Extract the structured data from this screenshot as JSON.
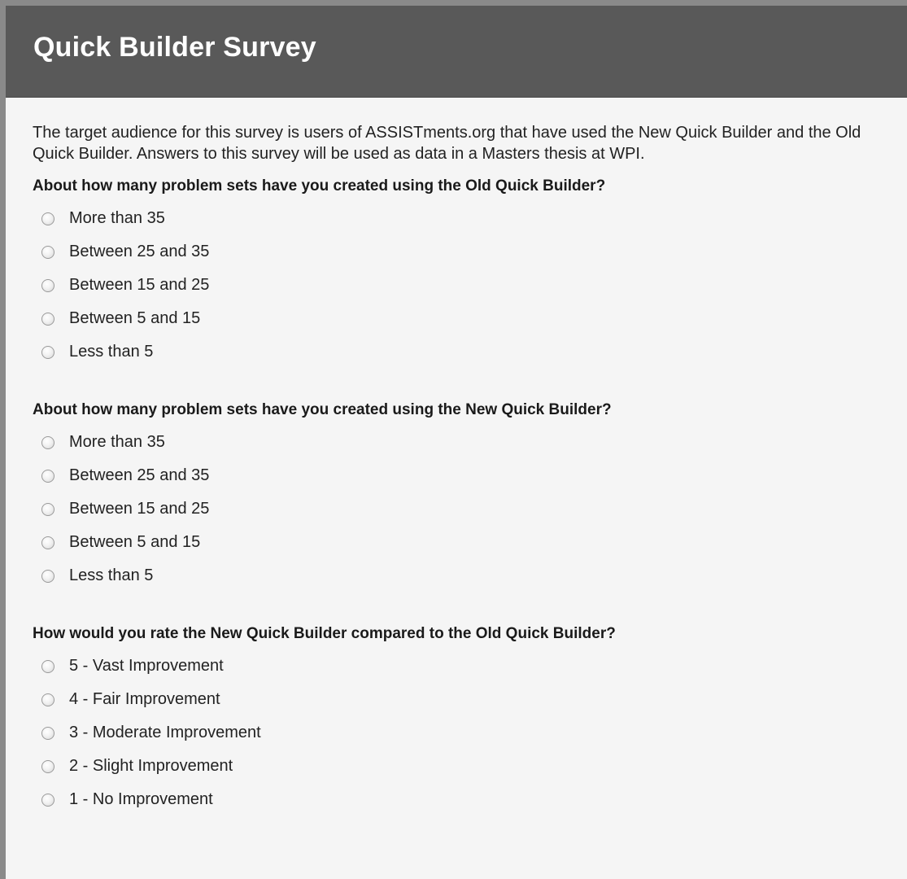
{
  "survey": {
    "title": "Quick Builder Survey",
    "intro": "The target audience for this survey is users of ASSISTments.org that have used the New Quick Builder and the Old Quick Builder. Answers to this survey will be used as data in a Masters thesis at WPI.",
    "questions": [
      {
        "title": "About how many problem sets have you created using the Old Quick Builder?",
        "options": [
          "More than 35",
          "Between 25 and 35",
          "Between 15 and 25",
          "Between 5 and 15",
          "Less than 5"
        ]
      },
      {
        "title": "About how many problem sets have you created using the New Quick Builder?",
        "options": [
          "More than 35",
          "Between 25 and 35",
          "Between 15 and 25",
          "Between 5 and 15",
          "Less than 5"
        ]
      },
      {
        "title": "How would you rate the New Quick Builder compared to the Old Quick Builder?",
        "options": [
          "5 - Vast Improvement",
          "4 - Fair Improvement",
          "3 - Moderate Improvement",
          "2 - Slight Improvement",
          "1 - No Improvement"
        ]
      }
    ]
  },
  "colors": {
    "header_bg": "#595959",
    "page_bg": "#f5f5f5",
    "frame_border": "#8a8a8a"
  }
}
